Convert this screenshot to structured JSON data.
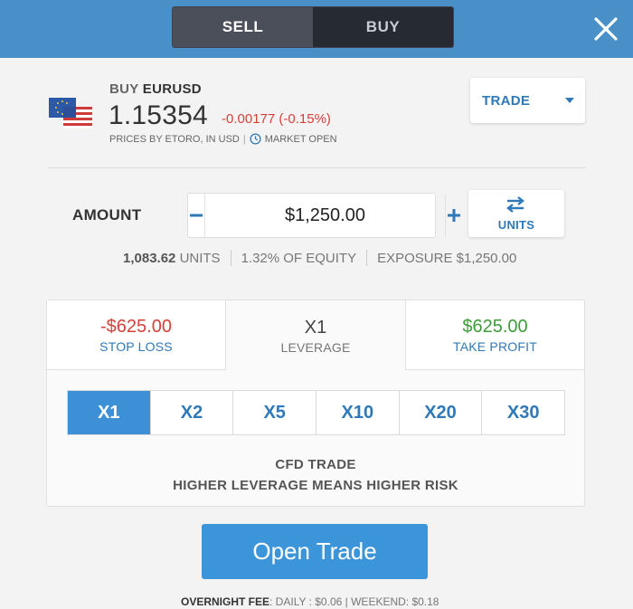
{
  "header": {
    "sell_label": "SELL",
    "buy_label": "BUY",
    "close_icon": "close-icon"
  },
  "instrument": {
    "action": "BUY",
    "symbol": "EURUSD",
    "price": "1.15354",
    "change": "-0.00177 (-0.15%)",
    "prices_by": "PRICES BY ETORO, IN USD",
    "separator": "|",
    "market_status": "MARKET OPEN",
    "flag_icon": "eu-us-flag-icon"
  },
  "order_type": {
    "selected": "TRADE",
    "icon": "chevron-down-icon"
  },
  "amount": {
    "label": "AMOUNT",
    "value": "$1,250.00",
    "units_label": "UNITS",
    "units_icon": "swap-arrows-icon"
  },
  "stats": {
    "units_value": "1,083.62",
    "units_label": "UNITS",
    "equity": "1.32% OF EQUITY",
    "exposure": "EXPOSURE $1,250.00"
  },
  "tabs": {
    "stop_loss": {
      "value": "-$625.00",
      "label": "STOP LOSS"
    },
    "leverage": {
      "value": "X1",
      "label": "LEVERAGE"
    },
    "take_profit": {
      "value": "$625.00",
      "label": "TAKE PROFIT"
    }
  },
  "leverage_options": [
    "X1",
    "X2",
    "X5",
    "X10",
    "X20",
    "X30"
  ],
  "leverage_selected": "X1",
  "risk": {
    "line1": "CFD TRADE",
    "line2": "HIGHER LEVERAGE MEANS HIGHER RISK"
  },
  "open_trade_label": "Open Trade",
  "fee": {
    "label": "OVERNIGHT FEE",
    "daily": ": DAILY : $0.06",
    "separator": "|",
    "weekend": "WEEKEND: $0.18"
  },
  "colors": {
    "header": "#4a90c8",
    "accent": "#2f79b9",
    "button": "#3d95d9",
    "negative": "#d6403a",
    "positive": "#3e9b3a"
  }
}
